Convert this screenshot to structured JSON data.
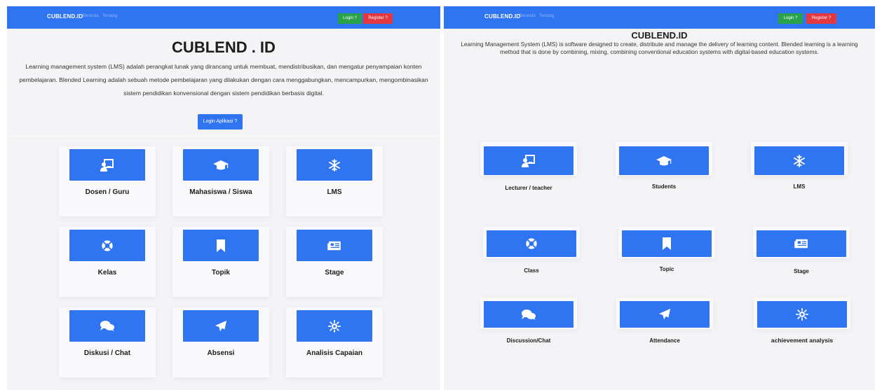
{
  "left_page": {
    "navbar": {
      "brand": "CUBLEND.ID",
      "nav_links": [
        "Beranda",
        "Tentang"
      ],
      "login_label": "Login ?",
      "register_label": "Register ?"
    },
    "hero": {
      "title": "CUBLEND . ID",
      "description": "Learning management system (LMS) adalah perangkat lunak yang dirancang untuk membuat, mendistribusikan, dan mengatur penyampaian konten pembelajaran. Blended Learning adalah sebuah metode pembelajaran yang dilakukan dengan cara menggabungkan, mencampurkan, mengombinasikan sistem pendidikan konvensional dengan sistem pendidikan berbasis digital.",
      "cta_label": "Login Aplikasi ?"
    },
    "tiles": [
      {
        "label": "Dosen / Guru",
        "icon": "chalkboard-teacher-icon"
      },
      {
        "label": "Mahasiswa / Siswa",
        "icon": "graduation-cap-icon"
      },
      {
        "label": "LMS",
        "icon": "snowflake-icon"
      },
      {
        "label": "Kelas",
        "icon": "life-ring-icon"
      },
      {
        "label": "Topik",
        "icon": "bookmark-icon"
      },
      {
        "label": "Stage",
        "icon": "newspaper-icon"
      },
      {
        "label": "Diskusi / Chat",
        "icon": "comments-icon"
      },
      {
        "label": "Absensi",
        "icon": "paper-plane-icon"
      },
      {
        "label": "Analisis Capaian",
        "icon": "sun-gear-icon"
      }
    ]
  },
  "right_page": {
    "navbar": {
      "brand": "CUBLEND.ID",
      "nav_links": [
        "Beranda",
        "Tentang"
      ],
      "login_label": "Login ?",
      "register_label": "Register ?"
    },
    "hero": {
      "title": "CUBLEND.ID",
      "description": "Learning Management System (LMS) is software designed to create, distribute and manage the delivery of learning content. Blended learning is a learning method that is done by combining, mixing, combining conventional education systems with digital-based education systems."
    },
    "tiles": [
      {
        "label": "Lecturer / teacher",
        "icon": "chalkboard-teacher-icon"
      },
      {
        "label": "Students",
        "icon": "graduation-cap-icon"
      },
      {
        "label": "LMS",
        "icon": "snowflake-icon"
      },
      {
        "label": "Class",
        "icon": "life-ring-icon"
      },
      {
        "label": "Topic",
        "icon": "bookmark-icon"
      },
      {
        "label": "Stage",
        "icon": "newspaper-icon"
      },
      {
        "label": "Discussion/Chat",
        "icon": "comments-icon"
      },
      {
        "label": "Attendance",
        "icon": "paper-plane-icon"
      },
      {
        "label": "achievement analysis",
        "icon": "sun-gear-icon"
      }
    ]
  },
  "colors": {
    "navbar": "#2f74f0",
    "tile_button": "#2f74f0",
    "login": "#2aa24a",
    "register": "#e3383f",
    "background": "#f4f4f6"
  }
}
